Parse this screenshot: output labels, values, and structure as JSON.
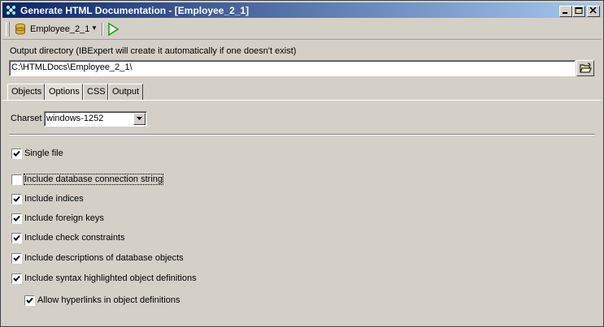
{
  "window": {
    "title": "Generate HTML Documentation - [Employee_2_1]",
    "controls": [
      "minimize",
      "maximize",
      "close"
    ]
  },
  "toolbar": {
    "database_label": "Employee_2_1",
    "run_icon": "play-icon",
    "database_icon": "database-icon"
  },
  "output": {
    "label": "Output directory (IBExpert will create it automatically if one doesn't exist)",
    "path": "C:\\HTMLDocs\\Employee_2_1\\",
    "browse_icon": "folder-open-icon"
  },
  "tabs": [
    {
      "label": "Objects",
      "active": false
    },
    {
      "label": "Options",
      "active": true
    },
    {
      "label": "CSS",
      "active": false
    },
    {
      "label": "Output",
      "active": false
    }
  ],
  "options": {
    "charset_label": "Charset",
    "charset_value": "windows-1252",
    "checkboxes": [
      {
        "label": "Single file",
        "checked": true
      },
      {
        "label": "Include database connection string",
        "checked": false
      },
      {
        "label": "Include indices",
        "checked": true
      },
      {
        "label": "Include foreign keys",
        "checked": true
      },
      {
        "label": "Include check constraints",
        "checked": true
      },
      {
        "label": "Include descriptions of database objects",
        "checked": true
      },
      {
        "label": "Include syntax highlighted object definitions",
        "checked": true
      },
      {
        "label": "Allow hyperlinks in object definitions",
        "checked": true
      }
    ]
  },
  "colors": {
    "titlebar_start": "#0a246a",
    "titlebar_end": "#a6caf0",
    "window_bg": "#d4d0c8",
    "run_green": "#1a9e1a"
  }
}
